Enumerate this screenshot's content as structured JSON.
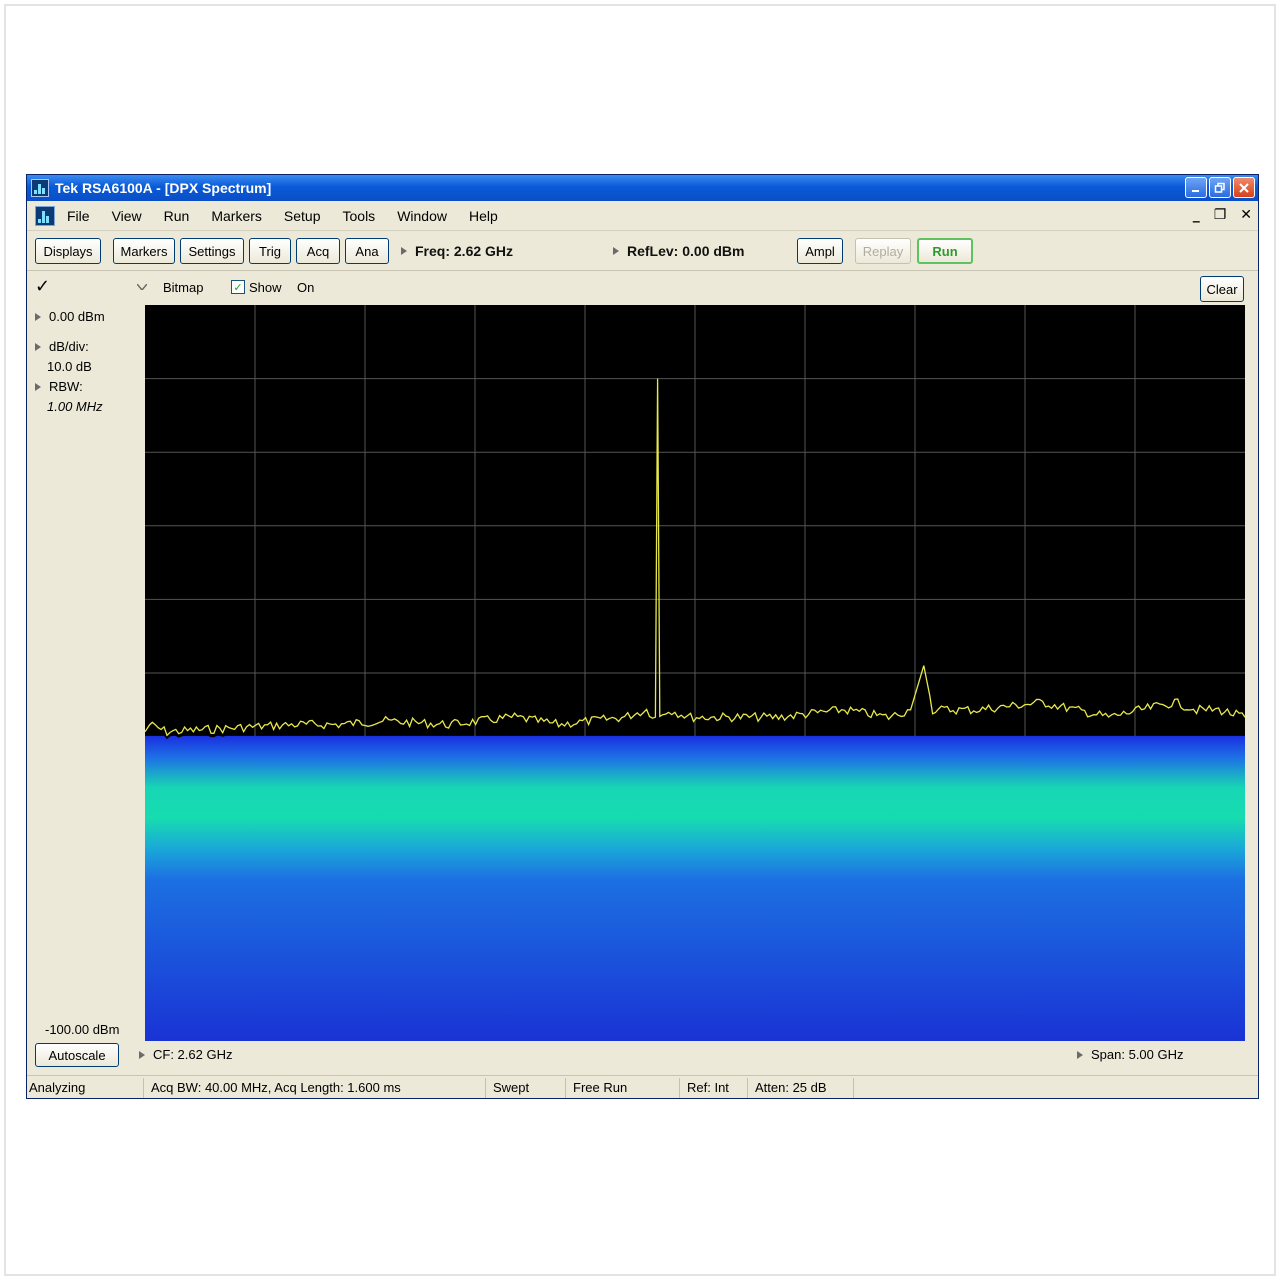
{
  "window": {
    "title": "Tek RSA6100A - [DPX Spectrum]"
  },
  "menu": {
    "items": [
      "File",
      "View",
      "Run",
      "Markers",
      "Setup",
      "Tools",
      "Window",
      "Help"
    ],
    "mdi_minimize": "_",
    "mdi_restore": "❐",
    "mdi_close": "✕"
  },
  "toolbar": {
    "displays": "Displays",
    "markers": "Markers",
    "settings": "Settings",
    "trig": "Trig",
    "acq": "Acq",
    "ana": "Ana",
    "freq": "Freq: 2.62 GHz",
    "reflev": "RefLev: 0.00 dBm",
    "ampl": "Ampl",
    "replay": "Replay",
    "run": "Run"
  },
  "display": {
    "check": "✓",
    "trace_type": "Bitmap",
    "show_label": "Show",
    "show_checked": true,
    "on_label": "On",
    "clear": "Clear"
  },
  "left_panel": {
    "ref_level": "0.00 dBm",
    "db_div_label": "dB/div:",
    "db_div_value": "10.0 dB",
    "rbw_label": "RBW:",
    "rbw_value": "1.00 MHz",
    "bottom_level": "-100.00 dBm",
    "autoscale": "Autoscale"
  },
  "bottom": {
    "cf": "CF: 2.62 GHz",
    "span": "Span: 5.00 GHz"
  },
  "status": {
    "state": "Analyzing",
    "acq": "Acq BW: 40.00 MHz, Acq Length: 1.600 ms",
    "mode": "Swept",
    "trigger": "Free Run",
    "ref": "Ref: Int",
    "atten": "Atten: 25 dB"
  },
  "colors": {
    "trace": "#e8e84a",
    "background": "#000000",
    "grid": "#555555",
    "density_high": "#16e0b0",
    "density_low": "#1a2fd8"
  },
  "chart_data": {
    "type": "line",
    "x_unit": "GHz",
    "y_unit": "dBm",
    "xlim": [
      0.12,
      5.12
    ],
    "ylim": [
      -100,
      0
    ],
    "grid": true,
    "series": [
      {
        "x": [
          0.12,
          0.14,
          0.22,
          0.5,
          0.8,
          1.0,
          1.2,
          1.5,
          1.8,
          2.0,
          2.3,
          2.4,
          2.44,
          2.45,
          2.46,
          2.5,
          2.6,
          2.8,
          3.0,
          3.3,
          3.5,
          3.6,
          3.66,
          3.7,
          3.9,
          4.2,
          4.5,
          4.8,
          4.9,
          5.0,
          5.12
        ],
        "y": [
          -58,
          -57,
          -58,
          -57.5,
          -57,
          -57,
          -56.5,
          -57,
          -56,
          -57,
          -56,
          -55,
          -56,
          -10,
          -56,
          -55,
          -56,
          -56,
          -56,
          -55,
          -56,
          -55,
          -49,
          -55,
          -55,
          -54,
          -56,
          -54,
          -55,
          -55,
          -56
        ]
      }
    ]
  }
}
